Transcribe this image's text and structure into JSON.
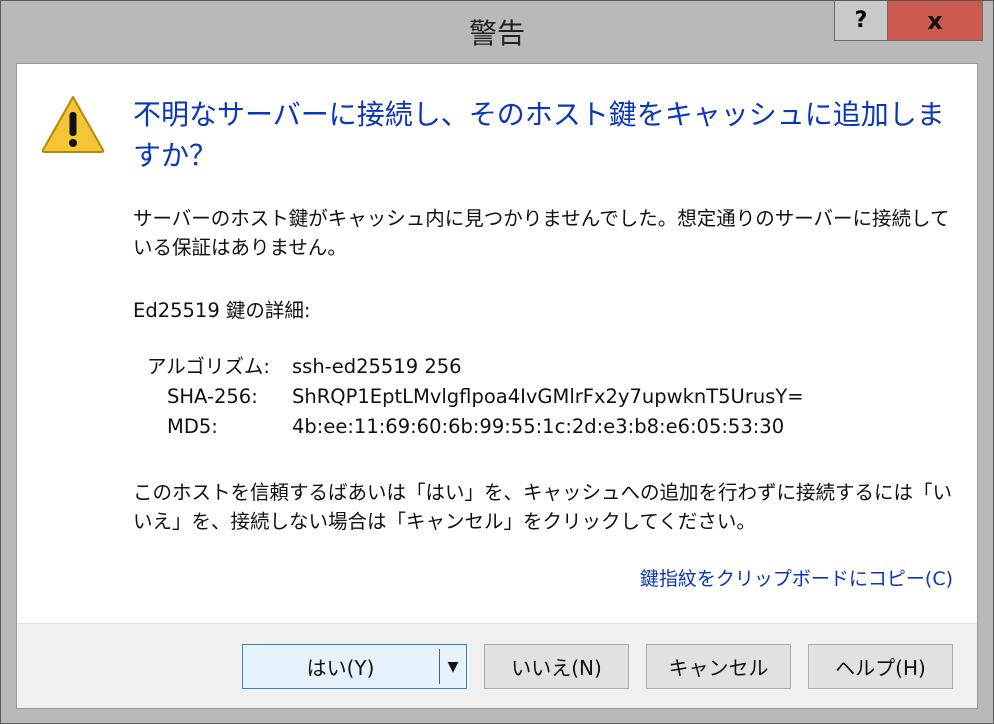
{
  "window": {
    "title": "警告",
    "help_glyph": "?",
    "close_glyph": "x"
  },
  "dialog": {
    "main_instruction": "不明なサーバーに接続し、そのホスト鍵をキャッシュに追加しますか？",
    "description": "サーバーのホスト鍵がキャッシュ内に見つかりませんでした。想定通りのサーバーに接続している保証はありません。",
    "key_header": "Ed25519 鍵の詳細:",
    "details": [
      {
        "label": "アルゴリズム:",
        "value": "ssh-ed25519 256"
      },
      {
        "label": "SHA-256:",
        "value": "ShRQP1EptLMvlgflpoa4IvGMlrFx2y7upwknT5UrusY="
      },
      {
        "label": "MD5:",
        "value": "4b:ee:11:69:60:6b:99:55:1c:2d:e3:b8:e6:05:53:30"
      }
    ],
    "instructions": "このホストを信頼するばあいは「はい」を、キャッシュへの追加を行わずに接続するには「いいえ」を、接続しない場合は「キャンセル」をクリックしてください。",
    "copy_link": "鍵指紋をクリップボードにコピー(C)"
  },
  "buttons": {
    "yes": "はい(Y)",
    "no": "いいえ(N)",
    "cancel": "キャンセル",
    "help": "ヘルプ(H)"
  },
  "colors": {
    "accent_text": "#0a36b8",
    "close_button": "#cd5a4e",
    "default_button_border": "#3c7fb1"
  }
}
